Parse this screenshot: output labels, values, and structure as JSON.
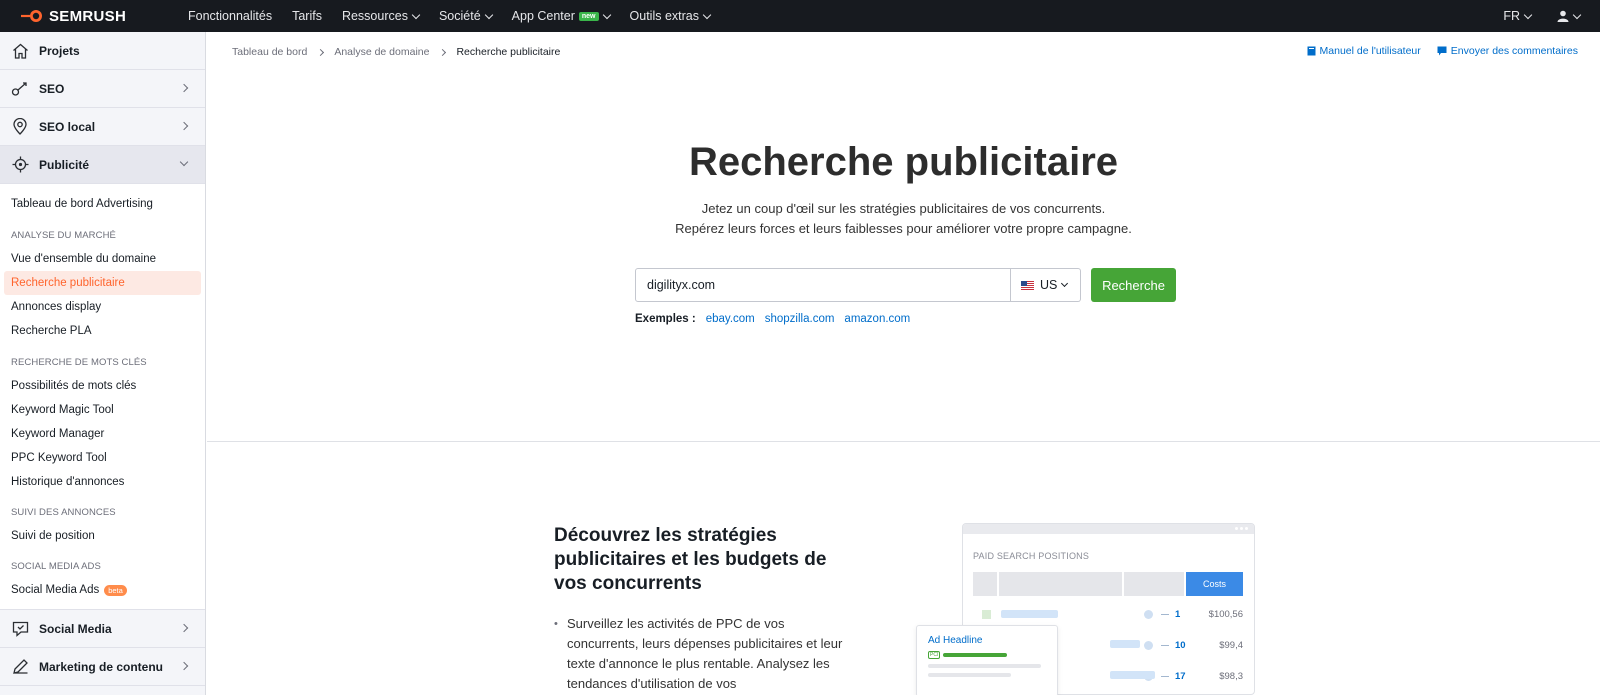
{
  "brand": {
    "name": "SEMRUSH",
    "accent": "#ff642d"
  },
  "topnav": {
    "items": [
      {
        "label": "Fonctionnalités",
        "dropdown": false
      },
      {
        "label": "Tarifs",
        "dropdown": false
      },
      {
        "label": "Ressources",
        "dropdown": true
      },
      {
        "label": "Société",
        "dropdown": true
      },
      {
        "label": "App Center",
        "dropdown": true,
        "badge": "new"
      },
      {
        "label": "Outils extras",
        "dropdown": true
      }
    ],
    "lang": "FR"
  },
  "sidebar": {
    "main": [
      {
        "label": "Projets",
        "icon": "home-icon"
      },
      {
        "label": "SEO",
        "icon": "seo-icon"
      },
      {
        "label": "SEO local",
        "icon": "location-pin-icon"
      },
      {
        "label": "Publicité",
        "icon": "target-icon"
      }
    ],
    "advertising_dashboard": "Tableau de bord Advertising",
    "cat_market": "ANALYSE DU MARCHÉ",
    "market_links": [
      "Vue d'ensemble du domaine",
      "Recherche publicitaire",
      "Annonces display",
      "Recherche PLA"
    ],
    "cat_keywords": "RECHERCHE DE MOTS CLÉS",
    "keyword_links": [
      "Possibilités de mots clés",
      "Keyword Magic Tool",
      "Keyword Manager",
      "PPC Keyword Tool",
      "Historique d'annonces"
    ],
    "cat_tracking": "SUIVI DES ANNONCES",
    "tracking_links": [
      "Suivi de position"
    ],
    "cat_social": "SOCIAL MEDIA ADS",
    "social_link": "Social Media Ads",
    "social_badge": "beta",
    "bottom": [
      {
        "label": "Social Media",
        "icon": "chat-icon"
      },
      {
        "label": "Marketing de contenu",
        "icon": "pen-icon"
      }
    ]
  },
  "breadcrumb": [
    "Tableau de bord",
    "Analyse de domaine",
    "Recherche publicitaire"
  ],
  "actions": {
    "manual": "Manuel de l'utilisateur",
    "feedback": "Envoyer des commentaires"
  },
  "hero": {
    "title": "Recherche publicitaire",
    "sub1": "Jetez un coup d'œil sur les stratégies publicitaires de vos concurrents.",
    "sub2": "Repérez leurs forces et leurs faiblesses pour améliorer votre propre campagne."
  },
  "search": {
    "value": "digilityx.com",
    "country": "US",
    "button": "Recherche",
    "button_color": "#46a537",
    "examples_label": "Exemples :",
    "examples": [
      "ebay.com",
      "shopzilla.com",
      "amazon.com"
    ]
  },
  "promo": {
    "title": "Découvrez les stratégies publicitaires et les budgets de vos concurrents",
    "bullet": "Surveillez les activités de PPC de vos concurrents, leurs dépenses publicitaires et leur texte d'annonce le plus rentable. Analysez les tendances d'utilisation de vos"
  },
  "illustration": {
    "title": "PAID SEARCH POSITIONS",
    "costs_header": "Costs",
    "rows": [
      {
        "pos": "1",
        "cost": "$100,56"
      },
      {
        "pos": "10",
        "cost": "$99,4"
      },
      {
        "pos": "17",
        "cost": "$98,3"
      }
    ],
    "ad_headline": "Ad Headline",
    "ad_tag": "PCI"
  }
}
